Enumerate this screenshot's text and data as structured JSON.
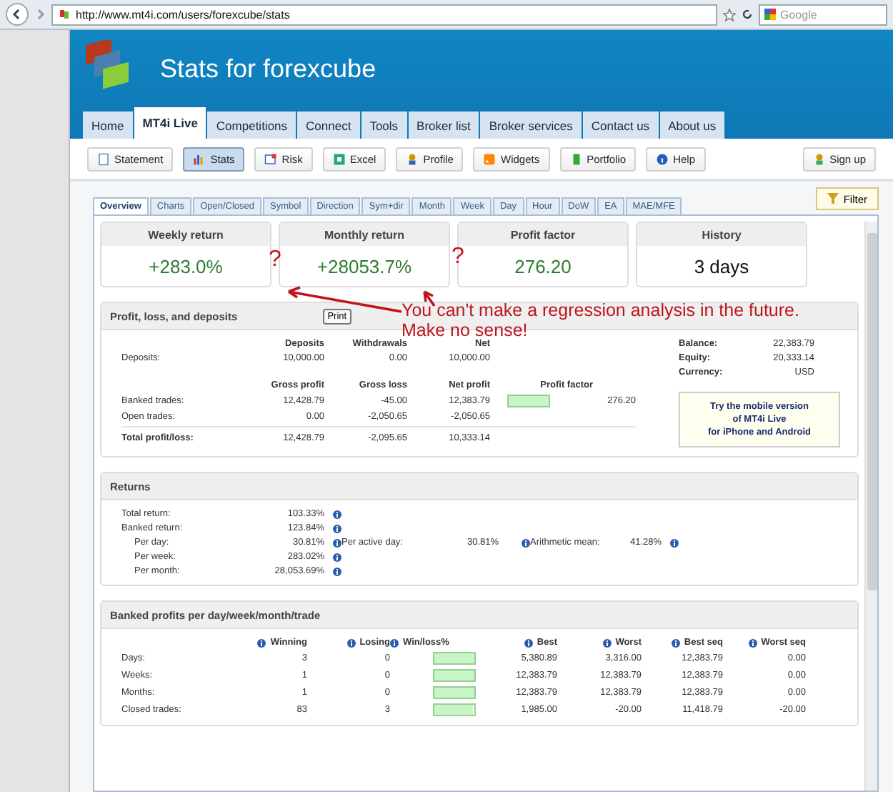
{
  "browser": {
    "url": "http://www.mt4i.com/users/forexcube/stats",
    "search_placeholder": "Google"
  },
  "site": {
    "title": "Stats for forexcube"
  },
  "nav": [
    {
      "label": "Home",
      "selected": false
    },
    {
      "label": "MT4i Live",
      "selected": true
    },
    {
      "label": "Competitions",
      "selected": false
    },
    {
      "label": "Connect",
      "selected": false
    },
    {
      "label": "Tools",
      "selected": false
    },
    {
      "label": "Broker list",
      "selected": false
    },
    {
      "label": "Broker services",
      "selected": false
    },
    {
      "label": "Contact us",
      "selected": false
    },
    {
      "label": "About us",
      "selected": false
    }
  ],
  "toolbar": [
    {
      "label": "Statement",
      "selected": false
    },
    {
      "label": "Stats",
      "selected": true
    },
    {
      "label": "Risk",
      "selected": false
    },
    {
      "label": "Excel",
      "selected": false
    },
    {
      "label": "Profile",
      "selected": false
    },
    {
      "label": "Widgets",
      "selected": false
    },
    {
      "label": "Portfolio",
      "selected": false
    },
    {
      "label": "Help",
      "selected": false
    }
  ],
  "signup_button": "Sign up",
  "filter_button": "Filter",
  "tabs": [
    {
      "label": "Overview",
      "selected": true
    },
    {
      "label": "Charts",
      "selected": false
    },
    {
      "label": "Open/Closed",
      "selected": false
    },
    {
      "label": "Symbol",
      "selected": false
    },
    {
      "label": "Direction",
      "selected": false
    },
    {
      "label": "Sym+dir",
      "selected": false
    },
    {
      "label": "Month",
      "selected": false
    },
    {
      "label": "Week",
      "selected": false
    },
    {
      "label": "Day",
      "selected": false
    },
    {
      "label": "Hour",
      "selected": false
    },
    {
      "label": "DoW",
      "selected": false
    },
    {
      "label": "EA",
      "selected": false
    },
    {
      "label": "MAE/MFE",
      "selected": false
    }
  ],
  "cards": [
    {
      "title": "Weekly return",
      "value": "+283.0%",
      "color": "#2e7d32"
    },
    {
      "title": "Monthly return",
      "value": "+28053.7%",
      "color": "#2e7d32"
    },
    {
      "title": "Profit factor",
      "value": "276.20",
      "color": "#2e7d32"
    },
    {
      "title": "History",
      "value": "3 days",
      "color": "#111111"
    }
  ],
  "profit": {
    "title": "Profit, loss, and deposits",
    "print_button": "Print",
    "deposit_columns": [
      "Deposits",
      "Withdrawals",
      "Net"
    ],
    "deposit_row": {
      "label": "Deposits:",
      "values": [
        "10,000.00",
        "0.00",
        "10,000.00"
      ]
    },
    "trade_columns": [
      "Gross profit",
      "Gross loss",
      "Net profit",
      "Profit factor"
    ],
    "trade_rows": [
      {
        "label": "Banked trades:",
        "values": [
          "12,428.79",
          "-45.00",
          "12,383.79"
        ],
        "level": 1,
        "factor": "276.20"
      },
      {
        "label": "Open trades:",
        "values": [
          "0.00",
          "-2,050.65",
          "-2,050.65"
        ]
      }
    ],
    "total_row": {
      "label": "Total profit/loss:",
      "values": [
        "12,428.79",
        "-2,095.65",
        "10,333.14"
      ]
    },
    "account": [
      {
        "label": "Balance:",
        "value": "22,383.79"
      },
      {
        "label": "Equity:",
        "value": "20,333.14"
      },
      {
        "label": "Currency:",
        "value": "USD"
      }
    ],
    "promo": [
      "Try the mobile version",
      "of MT4i Live",
      "for iPhone and Android"
    ]
  },
  "returns": {
    "title": "Returns",
    "rows": [
      {
        "label": "Total return:",
        "value": "103.33%",
        "indented": false
      },
      {
        "label": "Banked return:",
        "value": "123.84%",
        "indented": false
      },
      {
        "label": "Per day:",
        "value": "30.81%",
        "indented": true,
        "extra": [
          {
            "label": "Per active day:",
            "value": "30.81%"
          },
          {
            "label": "Arithmetic mean:",
            "value": "41.28%"
          }
        ]
      },
      {
        "label": "Per week:",
        "value": "283.02%",
        "indented": true
      },
      {
        "label": "Per month:",
        "value": "28,053.69%",
        "indented": true
      }
    ]
  },
  "banked": {
    "title": "Banked profits per day/week/month/trade",
    "columns": [
      "Winning",
      "Losing",
      "Win/loss%",
      "Best",
      "Worst",
      "Best seq",
      "Worst seq"
    ],
    "rows": [
      {
        "label": "Days:",
        "winning": "3",
        "losing": "0",
        "level": 1,
        "best": "5,380.89",
        "worst": "3,316.00",
        "best_seq": "12,383.79",
        "worst_seq": "0.00"
      },
      {
        "label": "Weeks:",
        "winning": "1",
        "losing": "0",
        "level": 1,
        "best": "12,383.79",
        "worst": "12,383.79",
        "best_seq": "12,383.79",
        "worst_seq": "0.00"
      },
      {
        "label": "Months:",
        "winning": "1",
        "losing": "0",
        "level": 1,
        "best": "12,383.79",
        "worst": "12,383.79",
        "best_seq": "12,383.79",
        "worst_seq": "0.00"
      },
      {
        "label": "Closed trades:",
        "winning": "83",
        "losing": "3",
        "level": 0.965,
        "best": "1,985.00",
        "worst": "-20.00",
        "best_seq": "11,418.79",
        "worst_seq": "-20.00"
      }
    ]
  },
  "annotation": {
    "marks": [
      "?",
      "?"
    ],
    "note": [
      "You can't make a regression analysis in the future.",
      "Make no sense!"
    ]
  }
}
